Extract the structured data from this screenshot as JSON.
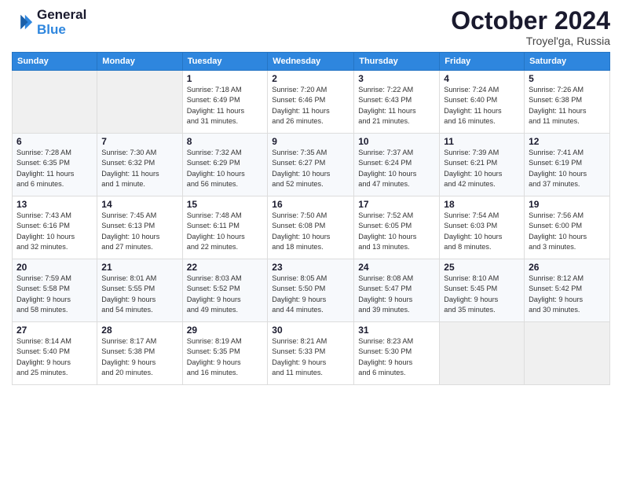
{
  "logo": {
    "line1": "General",
    "line2": "Blue"
  },
  "title": "October 2024",
  "location": "Troyel'ga, Russia",
  "weekdays": [
    "Sunday",
    "Monday",
    "Tuesday",
    "Wednesday",
    "Thursday",
    "Friday",
    "Saturday"
  ],
  "weeks": [
    [
      {
        "day": "",
        "info": ""
      },
      {
        "day": "",
        "info": ""
      },
      {
        "day": "1",
        "info": "Sunrise: 7:18 AM\nSunset: 6:49 PM\nDaylight: 11 hours\nand 31 minutes."
      },
      {
        "day": "2",
        "info": "Sunrise: 7:20 AM\nSunset: 6:46 PM\nDaylight: 11 hours\nand 26 minutes."
      },
      {
        "day": "3",
        "info": "Sunrise: 7:22 AM\nSunset: 6:43 PM\nDaylight: 11 hours\nand 21 minutes."
      },
      {
        "day": "4",
        "info": "Sunrise: 7:24 AM\nSunset: 6:40 PM\nDaylight: 11 hours\nand 16 minutes."
      },
      {
        "day": "5",
        "info": "Sunrise: 7:26 AM\nSunset: 6:38 PM\nDaylight: 11 hours\nand 11 minutes."
      }
    ],
    [
      {
        "day": "6",
        "info": "Sunrise: 7:28 AM\nSunset: 6:35 PM\nDaylight: 11 hours\nand 6 minutes."
      },
      {
        "day": "7",
        "info": "Sunrise: 7:30 AM\nSunset: 6:32 PM\nDaylight: 11 hours\nand 1 minute."
      },
      {
        "day": "8",
        "info": "Sunrise: 7:32 AM\nSunset: 6:29 PM\nDaylight: 10 hours\nand 56 minutes."
      },
      {
        "day": "9",
        "info": "Sunrise: 7:35 AM\nSunset: 6:27 PM\nDaylight: 10 hours\nand 52 minutes."
      },
      {
        "day": "10",
        "info": "Sunrise: 7:37 AM\nSunset: 6:24 PM\nDaylight: 10 hours\nand 47 minutes."
      },
      {
        "day": "11",
        "info": "Sunrise: 7:39 AM\nSunset: 6:21 PM\nDaylight: 10 hours\nand 42 minutes."
      },
      {
        "day": "12",
        "info": "Sunrise: 7:41 AM\nSunset: 6:19 PM\nDaylight: 10 hours\nand 37 minutes."
      }
    ],
    [
      {
        "day": "13",
        "info": "Sunrise: 7:43 AM\nSunset: 6:16 PM\nDaylight: 10 hours\nand 32 minutes."
      },
      {
        "day": "14",
        "info": "Sunrise: 7:45 AM\nSunset: 6:13 PM\nDaylight: 10 hours\nand 27 minutes."
      },
      {
        "day": "15",
        "info": "Sunrise: 7:48 AM\nSunset: 6:11 PM\nDaylight: 10 hours\nand 22 minutes."
      },
      {
        "day": "16",
        "info": "Sunrise: 7:50 AM\nSunset: 6:08 PM\nDaylight: 10 hours\nand 18 minutes."
      },
      {
        "day": "17",
        "info": "Sunrise: 7:52 AM\nSunset: 6:05 PM\nDaylight: 10 hours\nand 13 minutes."
      },
      {
        "day": "18",
        "info": "Sunrise: 7:54 AM\nSunset: 6:03 PM\nDaylight: 10 hours\nand 8 minutes."
      },
      {
        "day": "19",
        "info": "Sunrise: 7:56 AM\nSunset: 6:00 PM\nDaylight: 10 hours\nand 3 minutes."
      }
    ],
    [
      {
        "day": "20",
        "info": "Sunrise: 7:59 AM\nSunset: 5:58 PM\nDaylight: 9 hours\nand 58 minutes."
      },
      {
        "day": "21",
        "info": "Sunrise: 8:01 AM\nSunset: 5:55 PM\nDaylight: 9 hours\nand 54 minutes."
      },
      {
        "day": "22",
        "info": "Sunrise: 8:03 AM\nSunset: 5:52 PM\nDaylight: 9 hours\nand 49 minutes."
      },
      {
        "day": "23",
        "info": "Sunrise: 8:05 AM\nSunset: 5:50 PM\nDaylight: 9 hours\nand 44 minutes."
      },
      {
        "day": "24",
        "info": "Sunrise: 8:08 AM\nSunset: 5:47 PM\nDaylight: 9 hours\nand 39 minutes."
      },
      {
        "day": "25",
        "info": "Sunrise: 8:10 AM\nSunset: 5:45 PM\nDaylight: 9 hours\nand 35 minutes."
      },
      {
        "day": "26",
        "info": "Sunrise: 8:12 AM\nSunset: 5:42 PM\nDaylight: 9 hours\nand 30 minutes."
      }
    ],
    [
      {
        "day": "27",
        "info": "Sunrise: 8:14 AM\nSunset: 5:40 PM\nDaylight: 9 hours\nand 25 minutes."
      },
      {
        "day": "28",
        "info": "Sunrise: 8:17 AM\nSunset: 5:38 PM\nDaylight: 9 hours\nand 20 minutes."
      },
      {
        "day": "29",
        "info": "Sunrise: 8:19 AM\nSunset: 5:35 PM\nDaylight: 9 hours\nand 16 minutes."
      },
      {
        "day": "30",
        "info": "Sunrise: 8:21 AM\nSunset: 5:33 PM\nDaylight: 9 hours\nand 11 minutes."
      },
      {
        "day": "31",
        "info": "Sunrise: 8:23 AM\nSunset: 5:30 PM\nDaylight: 9 hours\nand 6 minutes."
      },
      {
        "day": "",
        "info": ""
      },
      {
        "day": "",
        "info": ""
      }
    ]
  ]
}
